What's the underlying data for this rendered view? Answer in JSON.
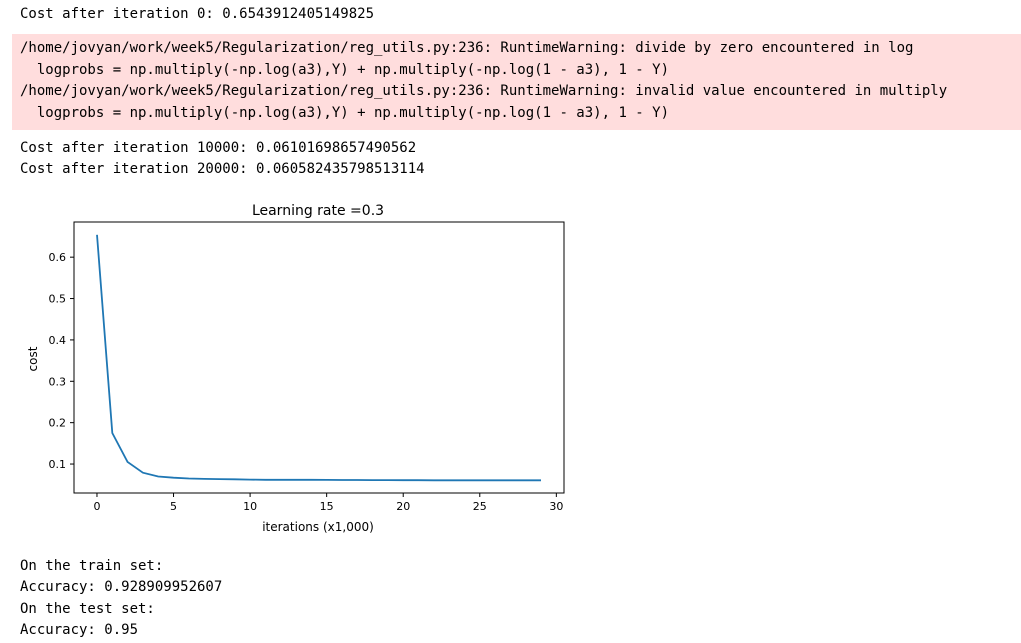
{
  "output": {
    "cost_lines_top": [
      "Cost after iteration 0: 0.6543912405149825"
    ],
    "warning_lines": [
      "/home/jovyan/work/week5/Regularization/reg_utils.py:236: RuntimeWarning: divide by zero encountered in log",
      "  logprobs = np.multiply(-np.log(a3),Y) + np.multiply(-np.log(1 - a3), 1 - Y)",
      "/home/jovyan/work/week5/Regularization/reg_utils.py:236: RuntimeWarning: invalid value encountered in multiply",
      "  logprobs = np.multiply(-np.log(a3),Y) + np.multiply(-np.log(1 - a3), 1 - Y)"
    ],
    "cost_lines_bottom": [
      "Cost after iteration 10000: 0.06101698657490562",
      "Cost after iteration 20000: 0.060582435798513114"
    ],
    "results_lines": [
      "On the train set:",
      "Accuracy: 0.928909952607",
      "On the test set:",
      "Accuracy: 0.95"
    ]
  },
  "chart_data": {
    "type": "line",
    "title": "Learning rate =0.3",
    "xlabel": "iterations (x1,000)",
    "ylabel": "cost",
    "xlim": [
      -1.5,
      30.5
    ],
    "ylim": [
      0.03,
      0.685
    ],
    "xticks": [
      0,
      5,
      10,
      15,
      20,
      25,
      30
    ],
    "xtick_labels": [
      "0",
      "5",
      "10",
      "15",
      "20",
      "25",
      "30"
    ],
    "yticks": [
      0.1,
      0.2,
      0.3,
      0.4,
      0.5,
      0.6
    ],
    "ytick_labels": [
      "0.1",
      "0.2",
      "0.3",
      "0.4",
      "0.5",
      "0.6"
    ],
    "grid": false,
    "line_color": "#1f77b4",
    "series": [
      {
        "x": [
          0,
          1,
          2,
          3,
          4,
          5,
          6,
          7,
          8,
          9,
          10,
          11,
          12,
          13,
          14,
          15,
          16,
          17,
          18,
          19,
          20,
          21,
          22,
          23,
          24,
          25,
          26,
          27,
          28,
          29
        ],
        "values": [
          0.654,
          0.175,
          0.105,
          0.079,
          0.07,
          0.067,
          0.065,
          0.064,
          0.0635,
          0.063,
          0.0625,
          0.062,
          0.062,
          0.062,
          0.0618,
          0.0616,
          0.0614,
          0.0613,
          0.0612,
          0.0611,
          0.061,
          0.0609,
          0.0608,
          0.0608,
          0.0607,
          0.0607,
          0.0606,
          0.0606,
          0.0606,
          0.0606
        ]
      }
    ]
  }
}
